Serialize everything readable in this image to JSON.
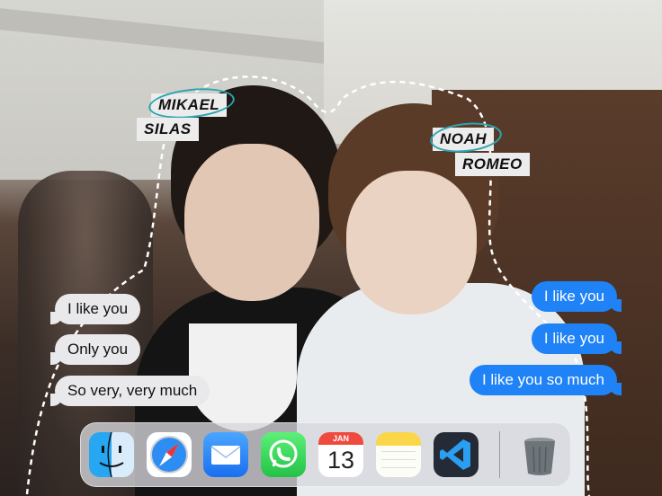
{
  "tags": {
    "left_top": "MIKAEL",
    "left_bottom": "SILAS",
    "right_top": "NOAH",
    "right_bottom": "ROMEO"
  },
  "messages": {
    "received": [
      "I like you",
      "Only you",
      "So very, very much"
    ],
    "sent": [
      "I like you",
      "I like you",
      "I like you so much"
    ]
  },
  "dock": {
    "apps": [
      "finder-icon",
      "safari-icon",
      "mail-icon",
      "whatsapp-icon",
      "calendar-icon",
      "notes-icon",
      "vscode-icon"
    ],
    "calendar_month": "JAN",
    "calendar_day": "13",
    "trash": "trash-icon"
  },
  "colors": {
    "sent_bubble": "#1f82f6",
    "received_bubble": "#e9e9eb",
    "ring": "#2ba5b0"
  }
}
